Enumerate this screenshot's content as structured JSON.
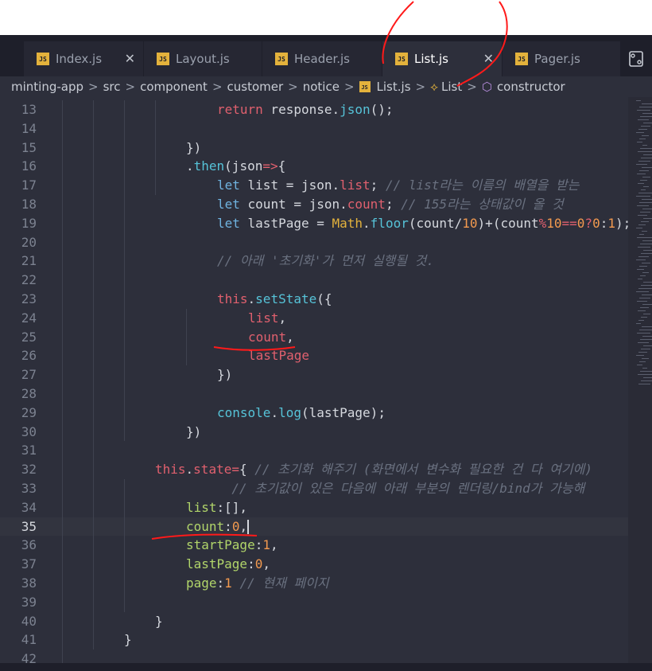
{
  "tabs": [
    {
      "icon": "JS",
      "label": "Index.js",
      "close": "✕",
      "active": false
    },
    {
      "icon": "JS",
      "label": "Layout.js",
      "close": "",
      "active": false
    },
    {
      "icon": "JS",
      "label": "Header.js",
      "close": "",
      "active": false
    },
    {
      "icon": "JS",
      "label": "List.js",
      "close": "✕",
      "active": true
    },
    {
      "icon": "JS",
      "label": "Pager.js",
      "close": "",
      "active": false
    }
  ],
  "split_icon": "split-compare-icon",
  "breadcrumb": {
    "items": [
      "minting-app",
      "src",
      "component",
      "customer",
      "notice"
    ],
    "file_icon": "JS",
    "file": "List.js",
    "class_name": "List",
    "method": "constructor",
    "separator": ">"
  },
  "colors": {
    "accent_red": "#e0606e",
    "annotation_red": "#ff1a1a",
    "editor_bg": "#2d2f3b"
  },
  "lines": [
    {
      "n": "13",
      "indent": 6,
      "tokens": [
        [
          "kw",
          "return"
        ],
        [
          "pl",
          " response."
        ],
        [
          "fn",
          "json"
        ],
        [
          "pl",
          "();"
        ]
      ]
    },
    {
      "n": "14",
      "indent": 0,
      "tokens": []
    },
    {
      "n": "15",
      "indent": 5,
      "tokens": [
        [
          "pl",
          "})"
        ]
      ]
    },
    {
      "n": "16",
      "indent": 5,
      "tokens": [
        [
          "pl",
          "."
        ],
        [
          "fn",
          "then"
        ],
        [
          "pl",
          "(json"
        ],
        [
          "op",
          "=>"
        ],
        [
          "pl",
          "{"
        ]
      ]
    },
    {
      "n": "17",
      "indent": 6,
      "tokens": [
        [
          "kw2",
          "let"
        ],
        [
          "pl",
          " list = json."
        ],
        [
          "varp",
          "list"
        ],
        [
          "pl",
          ";"
        ],
        [
          "cm",
          " // list라는 이름의 배열을 받는"
        ]
      ]
    },
    {
      "n": "18",
      "indent": 6,
      "tokens": [
        [
          "kw2",
          "let"
        ],
        [
          "pl",
          " count = json."
        ],
        [
          "varp",
          "count"
        ],
        [
          "pl",
          ";"
        ],
        [
          "cm",
          " // 155라는 상태값이 올 것"
        ]
      ]
    },
    {
      "n": "19",
      "indent": 6,
      "tokens": [
        [
          "kw2",
          "let"
        ],
        [
          "pl",
          " lastPage = "
        ],
        [
          "str",
          "Math"
        ],
        [
          "pl",
          "."
        ],
        [
          "fn",
          "floor"
        ],
        [
          "pl",
          "(count/"
        ],
        [
          "num",
          "10"
        ],
        [
          "pl",
          ")+(count"
        ],
        [
          "op",
          "%"
        ],
        [
          "num",
          "10"
        ],
        [
          "op",
          "=="
        ],
        [
          "num",
          "0"
        ],
        [
          "op",
          "?"
        ],
        [
          "num",
          "0"
        ],
        [
          "pl",
          ":"
        ],
        [
          "num",
          "1"
        ],
        [
          "pl",
          ");"
        ]
      ]
    },
    {
      "n": "20",
      "indent": 0,
      "tokens": []
    },
    {
      "n": "21",
      "indent": 6,
      "tokens": [
        [
          "cm",
          "// 아래 '초기화'가 먼저 실행될 것."
        ]
      ]
    },
    {
      "n": "22",
      "indent": 0,
      "tokens": []
    },
    {
      "n": "23",
      "indent": 6,
      "tokens": [
        [
          "kw",
          "this"
        ],
        [
          "pl",
          "."
        ],
        [
          "fn",
          "setState"
        ],
        [
          "pl",
          "({"
        ]
      ]
    },
    {
      "n": "24",
      "indent": 7,
      "tokens": [
        [
          "varp",
          "list"
        ],
        [
          "pl",
          ","
        ]
      ]
    },
    {
      "n": "25",
      "indent": 7,
      "tokens": [
        [
          "varp",
          "count"
        ],
        [
          "pl",
          ","
        ]
      ]
    },
    {
      "n": "26",
      "indent": 7,
      "tokens": [
        [
          "varp",
          "lastPage"
        ]
      ]
    },
    {
      "n": "27",
      "indent": 6,
      "tokens": [
        [
          "pl",
          "})"
        ]
      ]
    },
    {
      "n": "28",
      "indent": 0,
      "tokens": []
    },
    {
      "n": "29",
      "indent": 6,
      "tokens": [
        [
          "fn",
          "console"
        ],
        [
          "pl",
          "."
        ],
        [
          "fn",
          "log"
        ],
        [
          "pl",
          "(lastPage);"
        ]
      ]
    },
    {
      "n": "30",
      "indent": 5,
      "tokens": [
        [
          "pl",
          "})"
        ]
      ]
    },
    {
      "n": "31",
      "indent": 0,
      "tokens": []
    },
    {
      "n": "32",
      "indent": 4,
      "tokens": [
        [
          "kw",
          "this"
        ],
        [
          "pl",
          "."
        ],
        [
          "varp",
          "state"
        ],
        [
          "op",
          "="
        ],
        [
          "pl",
          "{"
        ],
        [
          "cm",
          " // 초기화 해주기 (화면에서 변수화 필요한 건 다 여기에)"
        ]
      ]
    },
    {
      "n": "33",
      "indent": 4,
      "tokens": [
        [
          "cm",
          "          // 초기값이 있은 다음에 아래 부분의 렌더링/bind가 가능해"
        ]
      ]
    },
    {
      "n": "34",
      "indent": 5,
      "tokens": [
        [
          "prop",
          "list"
        ],
        [
          "pl",
          ":[],"
        ]
      ]
    },
    {
      "n": "35",
      "indent": 5,
      "tokens": [
        [
          "prop",
          "count"
        ],
        [
          "pl",
          ":"
        ],
        [
          "num",
          "0"
        ],
        [
          "pl",
          ","
        ]
      ]
    },
    {
      "n": "36",
      "indent": 5,
      "tokens": [
        [
          "prop",
          "startPage"
        ],
        [
          "pl",
          ":"
        ],
        [
          "num",
          "1"
        ],
        [
          "pl",
          ","
        ]
      ]
    },
    {
      "n": "37",
      "indent": 5,
      "tokens": [
        [
          "prop",
          "lastPage"
        ],
        [
          "pl",
          ":"
        ],
        [
          "num",
          "0"
        ],
        [
          "pl",
          ","
        ]
      ]
    },
    {
      "n": "38",
      "indent": 5,
      "tokens": [
        [
          "prop",
          "page"
        ],
        [
          "pl",
          ":"
        ],
        [
          "num",
          "1"
        ],
        [
          "cm",
          " // 현재 페이지"
        ]
      ]
    },
    {
      "n": "39",
      "indent": 0,
      "tokens": []
    },
    {
      "n": "40",
      "indent": 4,
      "tokens": [
        [
          "pl",
          "}"
        ]
      ]
    },
    {
      "n": "41",
      "indent": 3,
      "tokens": [
        [
          "pl",
          "}"
        ]
      ]
    },
    {
      "n": "42",
      "indent": 0,
      "tokens": []
    }
  ],
  "current_line": "35"
}
